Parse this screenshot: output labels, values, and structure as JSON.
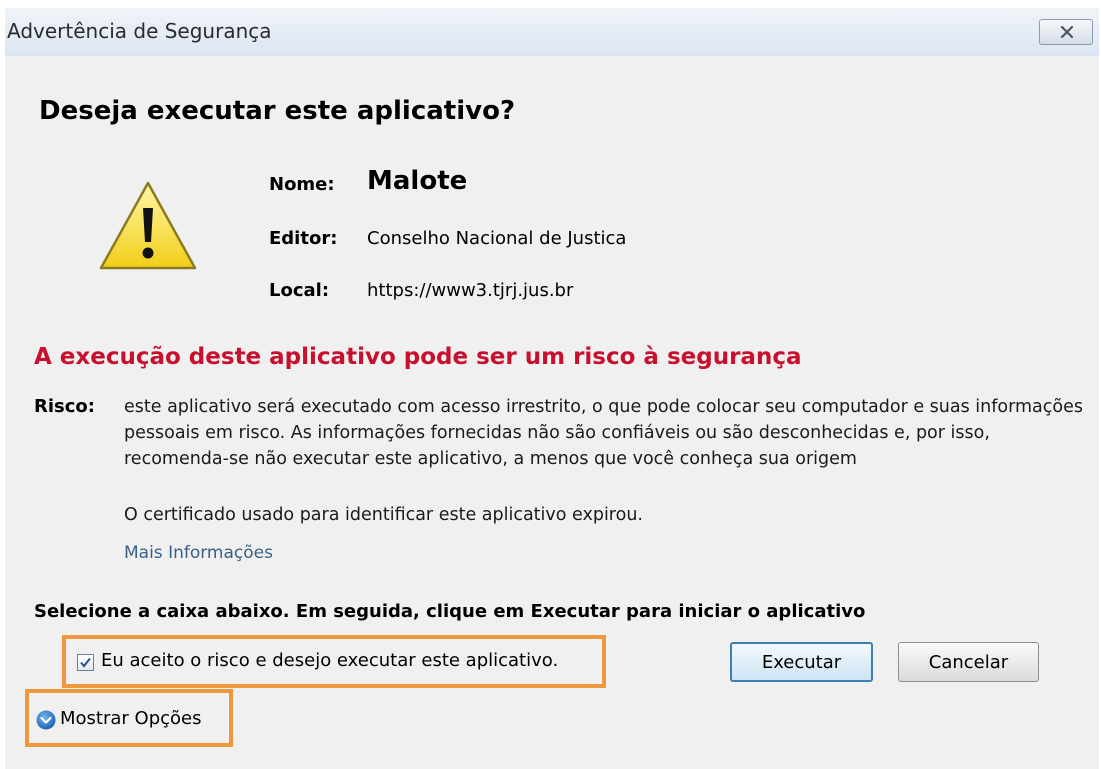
{
  "window": {
    "title": "Advertência de Segurança",
    "close_icon": "close-icon"
  },
  "dialog": {
    "heading": "Deseja executar este aplicativo?",
    "warning_icon": "warning-icon",
    "name_label": "Nome:",
    "name_value": "Malote",
    "editor_label": "Editor:",
    "editor_value": "Conselho Nacional de Justica",
    "local_label": "Local:",
    "local_value": "https://www3.tjrj.jus.br"
  },
  "risk": {
    "title": "A execução deste aplicativo pode ser um risco à segurança",
    "label": "Risco:",
    "text": "este aplicativo será executado com acesso irrestrito, o que pode colocar seu computador e suas informações pessoais em risco. As informações fornecidas não são confiáveis ou são desconhecidas e, por isso, recomenda-se não executar este aplicativo, a menos que você conheça sua origem",
    "certificate_text": "O certificado usado para identificar este aplicativo expirou.",
    "more_info_link": "Mais Informações"
  },
  "actions": {
    "instruction": "Selecione a caixa abaixo. Em seguida, clique em Executar para iniciar o aplicativo",
    "accept_checkbox_label": "Eu aceito o risco e desejo executar este aplicativo.",
    "accept_checked": true,
    "run_button": "Executar",
    "cancel_button": "Cancelar",
    "show_options": "Mostrar Opções",
    "expand_icon": "chevron-down-icon"
  },
  "colors": {
    "risk_title": "#c8102e",
    "link": "#3a5f87",
    "highlight": "#f0963c",
    "dialog_background": "#f0f0f0"
  }
}
